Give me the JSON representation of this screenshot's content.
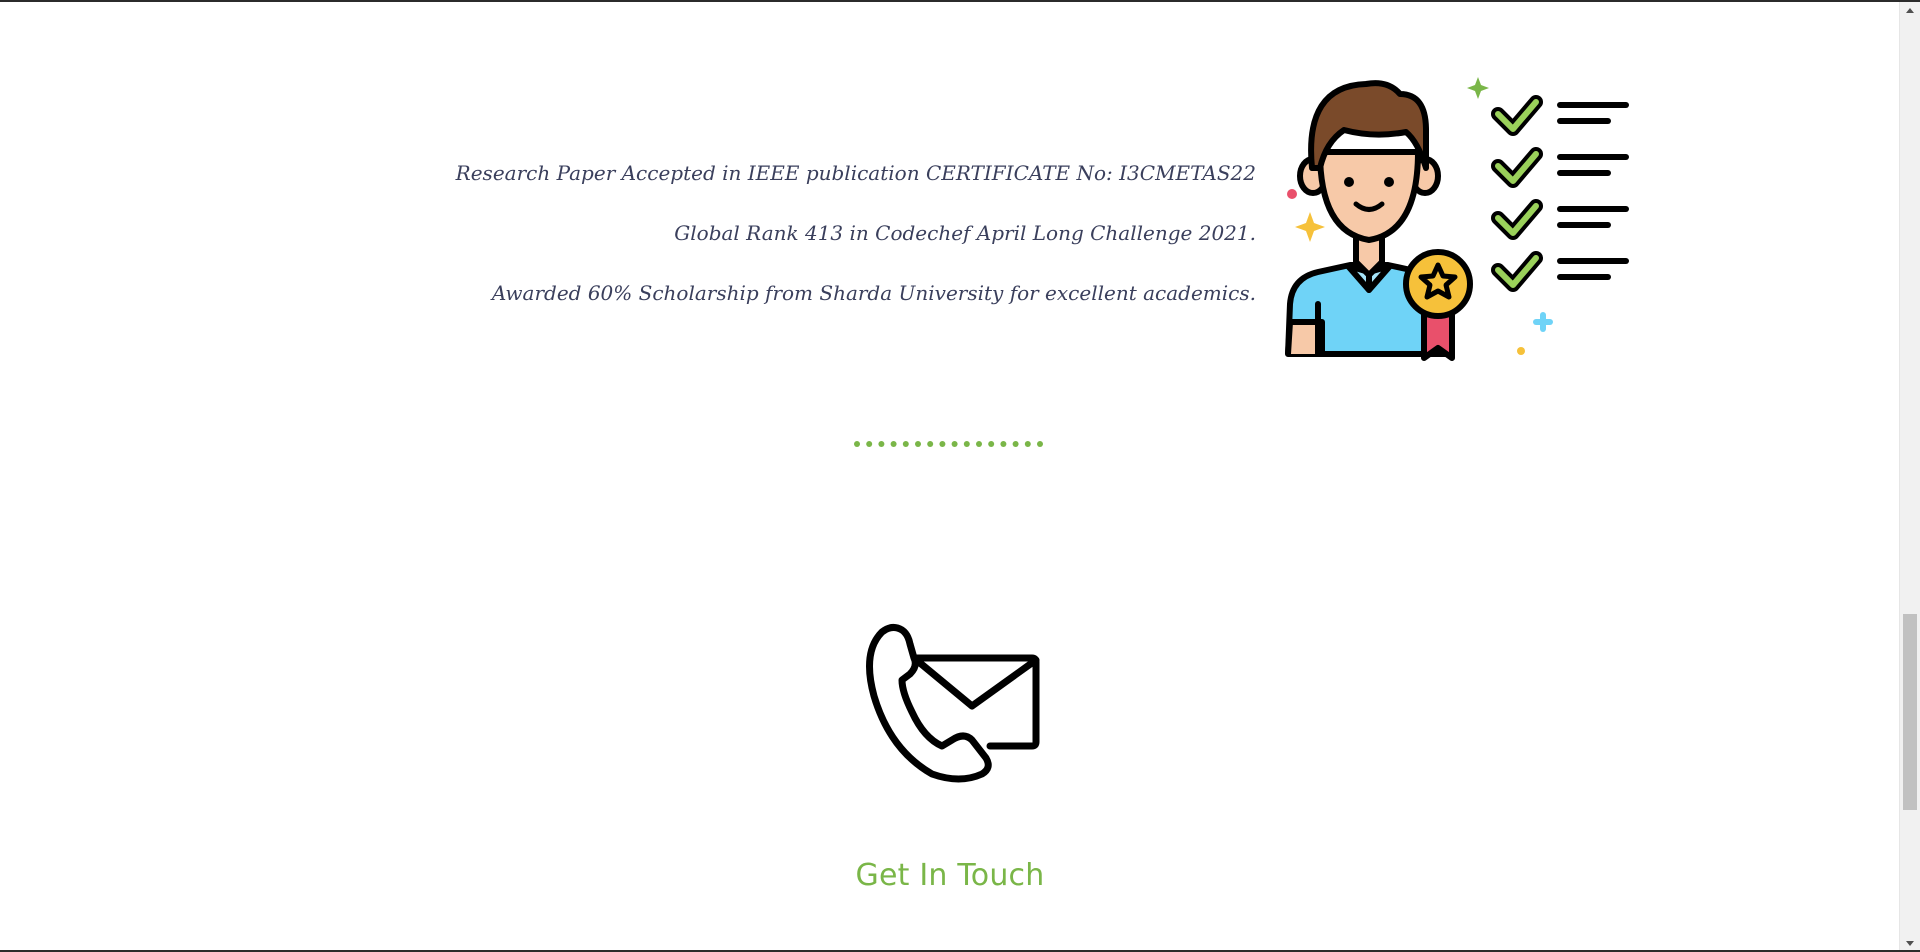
{
  "achievements": {
    "items": [
      "Research Paper Accepted in IEEE publication CERTIFICATE No: I3CMETAS22",
      "Global Rank 413 in Codechef April Long Challenge 2021.",
      "Awarded 60% Scholarship from Sharda University for excellent academics."
    ],
    "illustration_icon": "achiever-with-medal-and-checklist-icon"
  },
  "divider": {
    "dot_count": 16,
    "color": "#7ab648"
  },
  "contact": {
    "icon": "phone-envelope-icon",
    "title": "Get In Touch",
    "title_color": "#7ab648"
  },
  "scrollbar": {
    "position_fraction": 0.82
  },
  "colors": {
    "accent": "#7ab648",
    "text": "#3a3f5c",
    "shirt": "#6fd3f7",
    "hair": "#7a4a2a",
    "skin": "#f7c9a8",
    "medal": "#f6c13a",
    "ribbon": "#e9506b"
  }
}
